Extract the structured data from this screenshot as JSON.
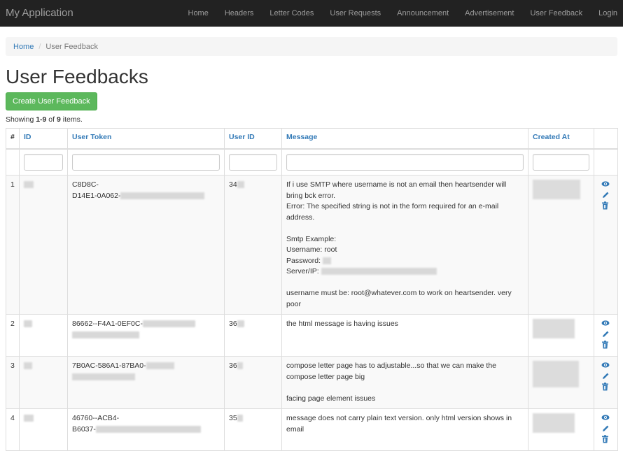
{
  "app": {
    "brand": "My Application"
  },
  "nav": {
    "items": [
      "Home",
      "Headers",
      "Letter Codes",
      "User Requests",
      "Announcement",
      "Advertisement",
      "User Feedback",
      "Login"
    ]
  },
  "breadcrumb": {
    "home": "Home",
    "separator": "/",
    "current": "User Feedback"
  },
  "page": {
    "title": "User Feedbacks",
    "create_label": "Create User Feedback"
  },
  "summary": {
    "prefix": "Showing ",
    "range": "1-9",
    "mid": " of ",
    "total": "9",
    "suffix": " items."
  },
  "table": {
    "headers": {
      "num": "#",
      "id": "ID",
      "user_token": "User Token",
      "user_id": "User ID",
      "message": "Message",
      "created_at": "Created At"
    },
    "rows": [
      {
        "num": "1",
        "token_line1": "C8D8C-",
        "token_line2": "D14E1-0A062-",
        "user_id": "34",
        "message": {
          "l1": "If i use SMTP where username is not an email then heartsender will bring bck error.",
          "l2": "Error: The specified string is not in the form required for an e-mail address.",
          "l3": "Smtp Example:",
          "l4": "Username: root",
          "l5": "Password:",
          "l6": "Server/IP:",
          "l7": "username must be: root@whatever.com to work on heartsender. very poor"
        }
      },
      {
        "num": "2",
        "token_line1": "86662--F4A1-0EF0C-",
        "user_id": "36",
        "message": {
          "l1": "the html message is having issues"
        }
      },
      {
        "num": "3",
        "token_line1": "7B0AC-586A1-87BA0-",
        "user_id": "36",
        "message": {
          "l1": "compose letter page has to adjustable...so that we can make the compose letter page big",
          "l2": "facing page element issues"
        }
      },
      {
        "num": "4",
        "token_line1": "46760--ACB4-",
        "token_line2": "B6037-",
        "user_id": "35",
        "message": {
          "l1": "message does not carry plain text version. only html version shows in email"
        }
      }
    ]
  },
  "colors": {
    "navbar": "#222222",
    "link": "#337ab7",
    "success": "#5cb85c"
  },
  "icons": {
    "view": "eye-icon",
    "update": "pencil-icon",
    "delete": "trash-icon"
  }
}
